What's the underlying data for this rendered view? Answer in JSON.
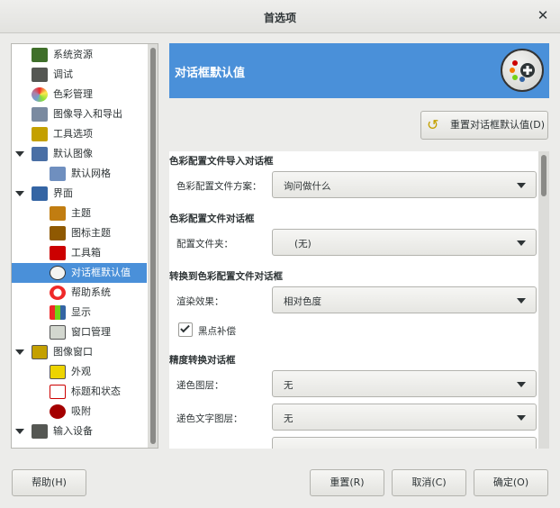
{
  "window": {
    "title": "首选项",
    "close_icon": "close-icon"
  },
  "sidebar": {
    "items": [
      {
        "label": "系统资源",
        "icon": "system-resources-icon",
        "color": "#3f6f2a"
      },
      {
        "label": "调试",
        "icon": "debug-icon",
        "color": "#555753"
      },
      {
        "label": "色彩管理",
        "icon": "color-management-icon",
        "color": "#d94a4a"
      },
      {
        "label": "图像导入和导出",
        "icon": "image-import-export-icon",
        "color": "#7a8aa0"
      },
      {
        "label": "工具选项",
        "icon": "tool-options-icon",
        "color": "#c4a000"
      },
      {
        "label": "默认图像",
        "icon": "default-image-icon",
        "color": "#4a6fa5"
      },
      {
        "label": "默认网格",
        "icon": "default-grid-icon",
        "color": "#6f8fbf"
      },
      {
        "label": "界面",
        "icon": "interface-icon",
        "color": "#3465a4"
      },
      {
        "label": "主题",
        "icon": "theme-icon",
        "color": "#c17d11"
      },
      {
        "label": "图标主题",
        "icon": "icon-theme-icon",
        "color": "#8f5902"
      },
      {
        "label": "工具箱",
        "icon": "toolbox-icon",
        "color": "#cc0000"
      },
      {
        "label": "对话框默认值",
        "icon": "dialog-defaults-icon",
        "color": "#f4f4f2"
      },
      {
        "label": "帮助系统",
        "icon": "help-system-icon",
        "color": "#ef2929"
      },
      {
        "label": "显示",
        "icon": "display-icon",
        "color": "#73d216"
      },
      {
        "label": "窗口管理",
        "icon": "window-management-icon",
        "color": "#d3d7cf"
      },
      {
        "label": "图像窗口",
        "icon": "image-window-icon",
        "color": "#c4a000"
      },
      {
        "label": "外观",
        "icon": "appearance-icon",
        "color": "#edd400"
      },
      {
        "label": "标题和状态",
        "icon": "title-status-icon",
        "color": "#cc0000"
      },
      {
        "label": "吸附",
        "icon": "snapping-icon",
        "color": "#a40000"
      },
      {
        "label": "输入设备",
        "icon": "input-devices-icon",
        "color": "#555753"
      }
    ]
  },
  "header": {
    "title": "对话框默认值",
    "icon": "dialog-defaults-large-icon"
  },
  "reset_defaults_button": {
    "label": "重置对话框默认值(D)",
    "icon": "reset-icon"
  },
  "sections": {
    "color_import": {
      "title": "色彩配置文件导入对话框",
      "field_label": "色彩配置文件方案：",
      "value": "询问做什么"
    },
    "color_profile": {
      "title": "色彩配置文件对话框",
      "field_label": "配置文件夹：",
      "value": "(无)"
    },
    "convert_profile": {
      "title": "转换到色彩配置文件对话框",
      "field_label": "渲染效果：",
      "value": "相对色度",
      "checkbox_label": "黑点补偿",
      "checkbox_checked": true
    },
    "precision": {
      "title": "精度转换对话框",
      "dither_layers_label": "递色图层：",
      "dither_layers_value": "无",
      "dither_text_label": "递色文字图层：",
      "dither_text_value": "无"
    }
  },
  "footer": {
    "help": "帮助(H)",
    "reset": "重置(R)",
    "cancel": "取消(C)",
    "ok": "确定(O)"
  }
}
